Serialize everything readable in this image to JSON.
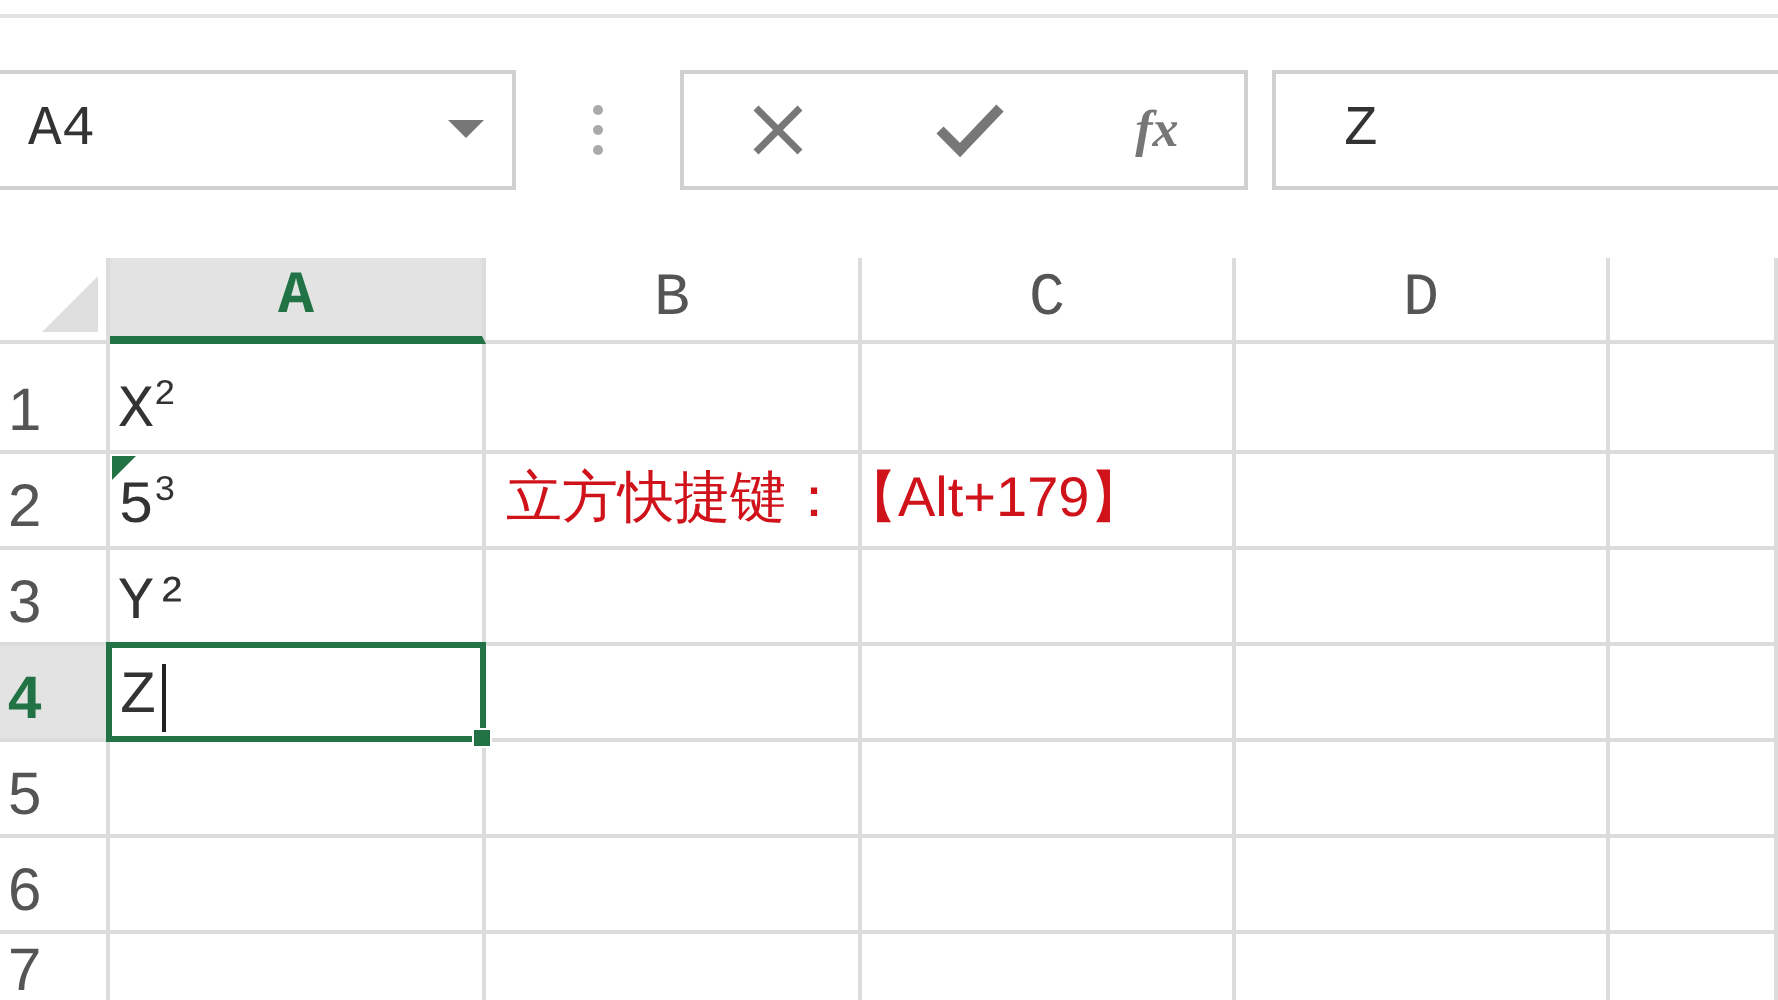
{
  "name_box": {
    "value": "A4"
  },
  "formula_bar": {
    "function_button": "fx",
    "value": "Z"
  },
  "columns": [
    {
      "label": "A",
      "selected": true
    },
    {
      "label": "B",
      "selected": false
    },
    {
      "label": "C",
      "selected": false
    },
    {
      "label": "D",
      "selected": false
    }
  ],
  "rows": [
    {
      "label": "1",
      "selected": false,
      "cells": [
        {
          "text": "X$^{2}$",
          "selected": false,
          "editing": false,
          "error_flag": false
        }
      ]
    },
    {
      "label": "2",
      "selected": false,
      "cells": [
        {
          "text": "5$^{3}$",
          "selected": false,
          "editing": false,
          "error_flag": true
        },
        {
          "text": "立方快捷键：【Alt+179】",
          "selected": false,
          "editing": false,
          "error_flag": false
        }
      ]
    },
    {
      "label": "3",
      "selected": false,
      "cells": [
        {
          "text": "Y²",
          "selected": false,
          "editing": false,
          "error_flag": false
        }
      ]
    },
    {
      "label": "4",
      "selected": true,
      "cells": [
        {
          "text": "Z",
          "selected": true,
          "editing": true,
          "error_flag": false
        }
      ]
    },
    {
      "label": "5",
      "selected": false,
      "cells": []
    },
    {
      "label": "6",
      "selected": false,
      "cells": []
    },
    {
      "label": "7",
      "selected": false,
      "cells": []
    }
  ]
}
